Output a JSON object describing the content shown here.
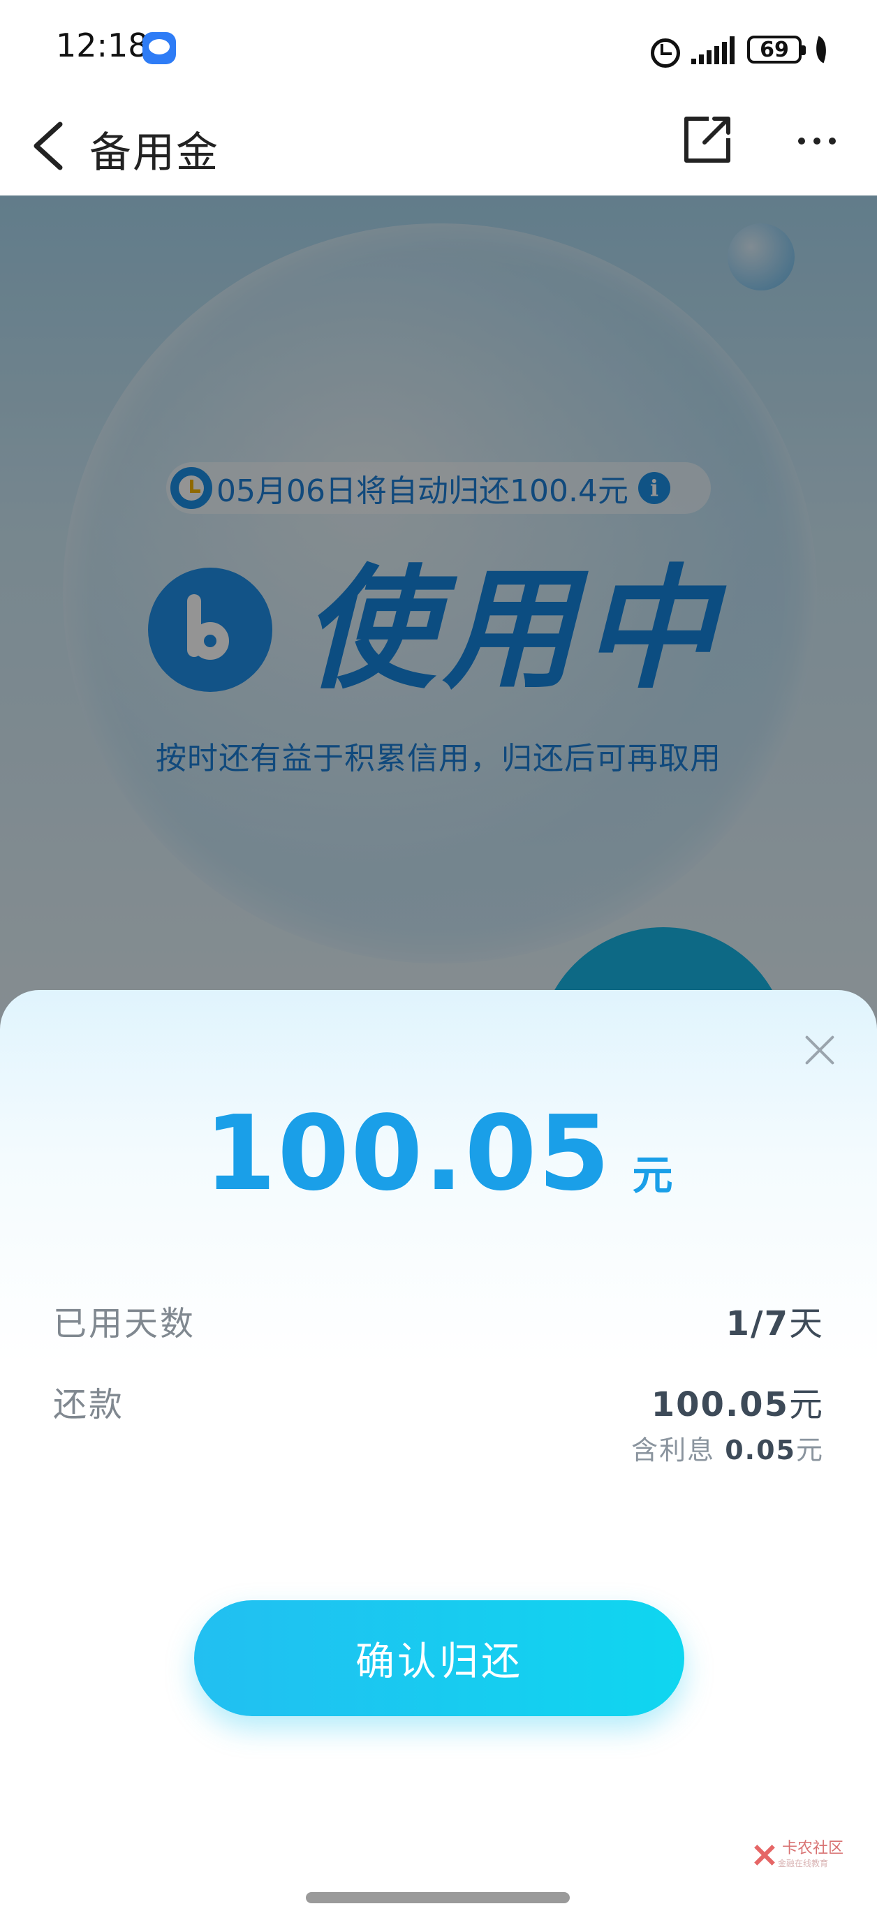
{
  "status_bar": {
    "time": "12:18",
    "battery": "69",
    "icons": [
      "message-icon",
      "alarm-icon",
      "signal-icon",
      "battery-icon",
      "leaf-icon"
    ]
  },
  "navbar": {
    "title": "备用金",
    "icons": [
      "back-icon",
      "share-icon",
      "more-icon"
    ]
  },
  "hero": {
    "notice": "05月06日将自动归还100.4元",
    "status": "使用中",
    "subtitle": "按时还有益于积累信用，归还后可再取用",
    "colors": {
      "accent": "#1585de",
      "bubble": "#17b6e6"
    }
  },
  "sheet": {
    "amount": "100.05",
    "amount_unit": "元",
    "rows": [
      {
        "label": "已用天数",
        "value_main": "1/7",
        "value_unit": "天"
      },
      {
        "label": "还款",
        "value_main": "100.05",
        "value_unit": "元"
      }
    ],
    "interest_label": "含利息",
    "interest_value": "0.05",
    "interest_unit": "元",
    "confirm_label": "确认归还",
    "colors": {
      "amount": "#1a9fe8",
      "button_start": "#22bff1",
      "button_end": "#0fd6f0"
    }
  },
  "watermark": {
    "text": "卡农社区",
    "sub": "金融在线教育"
  }
}
